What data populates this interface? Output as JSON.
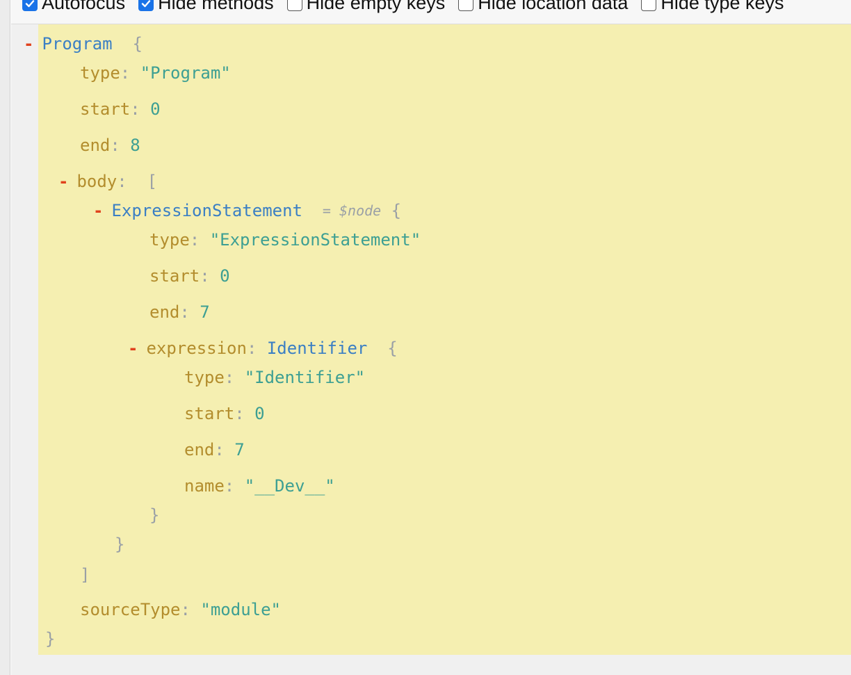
{
  "options": [
    {
      "label": "Autofocus",
      "checked": true
    },
    {
      "label": "Hide methods",
      "checked": true
    },
    {
      "label": "Hide empty keys",
      "checked": false
    },
    {
      "label": "Hide location data",
      "checked": false
    },
    {
      "label": "Hide type keys",
      "checked": false
    }
  ],
  "tree": {
    "toggle_symbol": "-",
    "root_type": "Program",
    "open_brace": "{",
    "close_brace": "}",
    "open_bracket": "[",
    "close_bracket": "]",
    "colon": ":",
    "program": {
      "type_key": "type",
      "type_value": "\"Program\"",
      "start_key": "start",
      "start_value": "0",
      "end_key": "end",
      "end_value": "8",
      "body_key": "body",
      "source_type_key": "sourceType",
      "source_type_value": "\"module\""
    },
    "expression_statement": {
      "node_type": "ExpressionStatement",
      "node_annotation": "= $node",
      "type_key": "type",
      "type_value": "\"ExpressionStatement\"",
      "start_key": "start",
      "start_value": "0",
      "end_key": "end",
      "end_value": "7",
      "expression_key": "expression"
    },
    "identifier": {
      "node_type": "Identifier",
      "type_key": "type",
      "type_value": "\"Identifier\"",
      "start_key": "start",
      "start_value": "0",
      "end_key": "end",
      "end_value": "7",
      "name_key": "name",
      "name_value": "\"__Dev__\""
    }
  },
  "colors": {
    "panel_background": "#f5efb1",
    "key": "#b38d2d",
    "string": "#3d9f93",
    "node_type": "#3b7fc4",
    "toggle": "#e0421d",
    "punctuation": "#9aa0a6",
    "checkbox_checked": "#1a73e8"
  }
}
